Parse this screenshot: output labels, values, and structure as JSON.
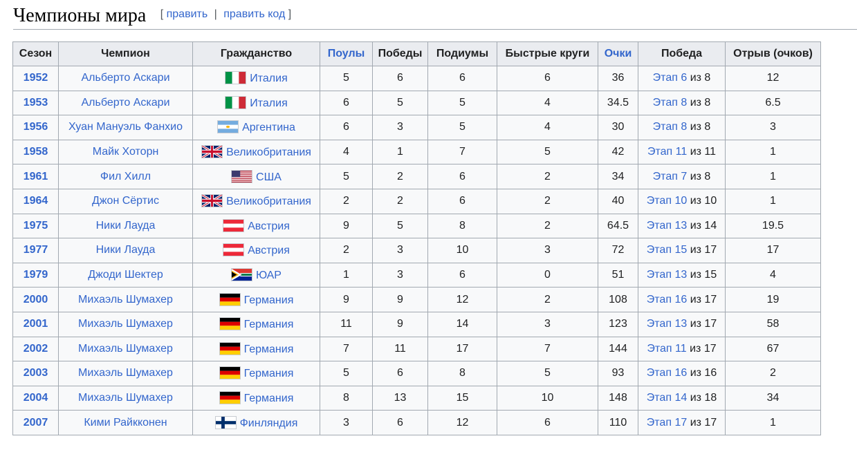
{
  "section": {
    "title": "Чемпионы мира",
    "edit_open": "[",
    "edit_label": "править",
    "edit_sep": "|",
    "edit_code_label": "править код",
    "edit_close": "]"
  },
  "table": {
    "headers": [
      "Сезон",
      "Чемпион",
      "Гражданство",
      "Поулы",
      "Победы",
      "Подиумы",
      "Быстрые круги",
      "Очки",
      "Победа",
      "Отрыв (очков)"
    ],
    "of_word": "из",
    "rows": [
      {
        "season": "1952",
        "driver": "Альберто Аскари",
        "flag": "italy",
        "nation": "Италия",
        "poles": "5",
        "wins": "6",
        "podiums": "6",
        "fastest_laps": "6",
        "points": "36",
        "stage": "Этап 6",
        "of_total": "8",
        "margin": "12"
      },
      {
        "season": "1953",
        "driver": "Альберто Аскари",
        "flag": "italy",
        "nation": "Италия",
        "poles": "6",
        "wins": "5",
        "podiums": "5",
        "fastest_laps": "4",
        "points": "34.5",
        "stage": "Этап 8",
        "of_total": "8",
        "margin": "6.5"
      },
      {
        "season": "1956",
        "driver": "Хуан Мануэль Фанхио",
        "flag": "argentina",
        "nation": "Аргентина",
        "poles": "6",
        "wins": "3",
        "podiums": "5",
        "fastest_laps": "4",
        "points": "30",
        "stage": "Этап 8",
        "of_total": "8",
        "margin": "3"
      },
      {
        "season": "1958",
        "driver": "Майк Хоторн",
        "flag": "uk",
        "nation": "Великобритания",
        "poles": "4",
        "wins": "1",
        "podiums": "7",
        "fastest_laps": "5",
        "points": "42",
        "stage": "Этап 11",
        "of_total": "11",
        "margin": "1"
      },
      {
        "season": "1961",
        "driver": "Фил Хилл",
        "flag": "usa",
        "nation": "США",
        "poles": "5",
        "wins": "2",
        "podiums": "6",
        "fastest_laps": "2",
        "points": "34",
        "stage": "Этап 7",
        "of_total": "8",
        "margin": "1"
      },
      {
        "season": "1964",
        "driver": "Джон Сёртис",
        "flag": "uk",
        "nation": "Великобритания",
        "poles": "2",
        "wins": "2",
        "podiums": "6",
        "fastest_laps": "2",
        "points": "40",
        "stage": "Этап 10",
        "of_total": "10",
        "margin": "1"
      },
      {
        "season": "1975",
        "driver": "Ники Лауда",
        "flag": "austria",
        "nation": "Австрия",
        "poles": "9",
        "wins": "5",
        "podiums": "8",
        "fastest_laps": "2",
        "points": "64.5",
        "stage": "Этап 13",
        "of_total": "14",
        "margin": "19.5"
      },
      {
        "season": "1977",
        "driver": "Ники Лауда",
        "flag": "austria",
        "nation": "Австрия",
        "poles": "2",
        "wins": "3",
        "podiums": "10",
        "fastest_laps": "3",
        "points": "72",
        "stage": "Этап 15",
        "of_total": "17",
        "margin": "17"
      },
      {
        "season": "1979",
        "driver": "Джоди Шектер",
        "flag": "south-africa",
        "nation": "ЮАР",
        "poles": "1",
        "wins": "3",
        "podiums": "6",
        "fastest_laps": "0",
        "points": "51",
        "stage": "Этап 13",
        "of_total": "15",
        "margin": "4"
      },
      {
        "season": "2000",
        "driver": "Михаэль Шумахер",
        "flag": "germany",
        "nation": "Германия",
        "poles": "9",
        "wins": "9",
        "podiums": "12",
        "fastest_laps": "2",
        "points": "108",
        "stage": "Этап 16",
        "of_total": "17",
        "margin": "19"
      },
      {
        "season": "2001",
        "driver": "Михаэль Шумахер",
        "flag": "germany",
        "nation": "Германия",
        "poles": "11",
        "wins": "9",
        "podiums": "14",
        "fastest_laps": "3",
        "points": "123",
        "stage": "Этап 13",
        "of_total": "17",
        "margin": "58"
      },
      {
        "season": "2002",
        "driver": "Михаэль Шумахер",
        "flag": "germany",
        "nation": "Германия",
        "poles": "7",
        "wins": "11",
        "podiums": "17",
        "fastest_laps": "7",
        "points": "144",
        "stage": "Этап 11",
        "of_total": "17",
        "margin": "67"
      },
      {
        "season": "2003",
        "driver": "Михаэль Шумахер",
        "flag": "germany",
        "nation": "Германия",
        "poles": "5",
        "wins": "6",
        "podiums": "8",
        "fastest_laps": "5",
        "points": "93",
        "stage": "Этап 16",
        "of_total": "16",
        "margin": "2"
      },
      {
        "season": "2004",
        "driver": "Михаэль Шумахер",
        "flag": "germany",
        "nation": "Германия",
        "poles": "8",
        "wins": "13",
        "podiums": "15",
        "fastest_laps": "10",
        "points": "148",
        "stage": "Этап 14",
        "of_total": "18",
        "margin": "34"
      },
      {
        "season": "2007",
        "driver": "Кими Райкконен",
        "flag": "finland",
        "nation": "Финляндия",
        "poles": "3",
        "wins": "6",
        "podiums": "12",
        "fastest_laps": "6",
        "points": "110",
        "stage": "Этап 17",
        "of_total": "17",
        "margin": "1"
      }
    ]
  }
}
